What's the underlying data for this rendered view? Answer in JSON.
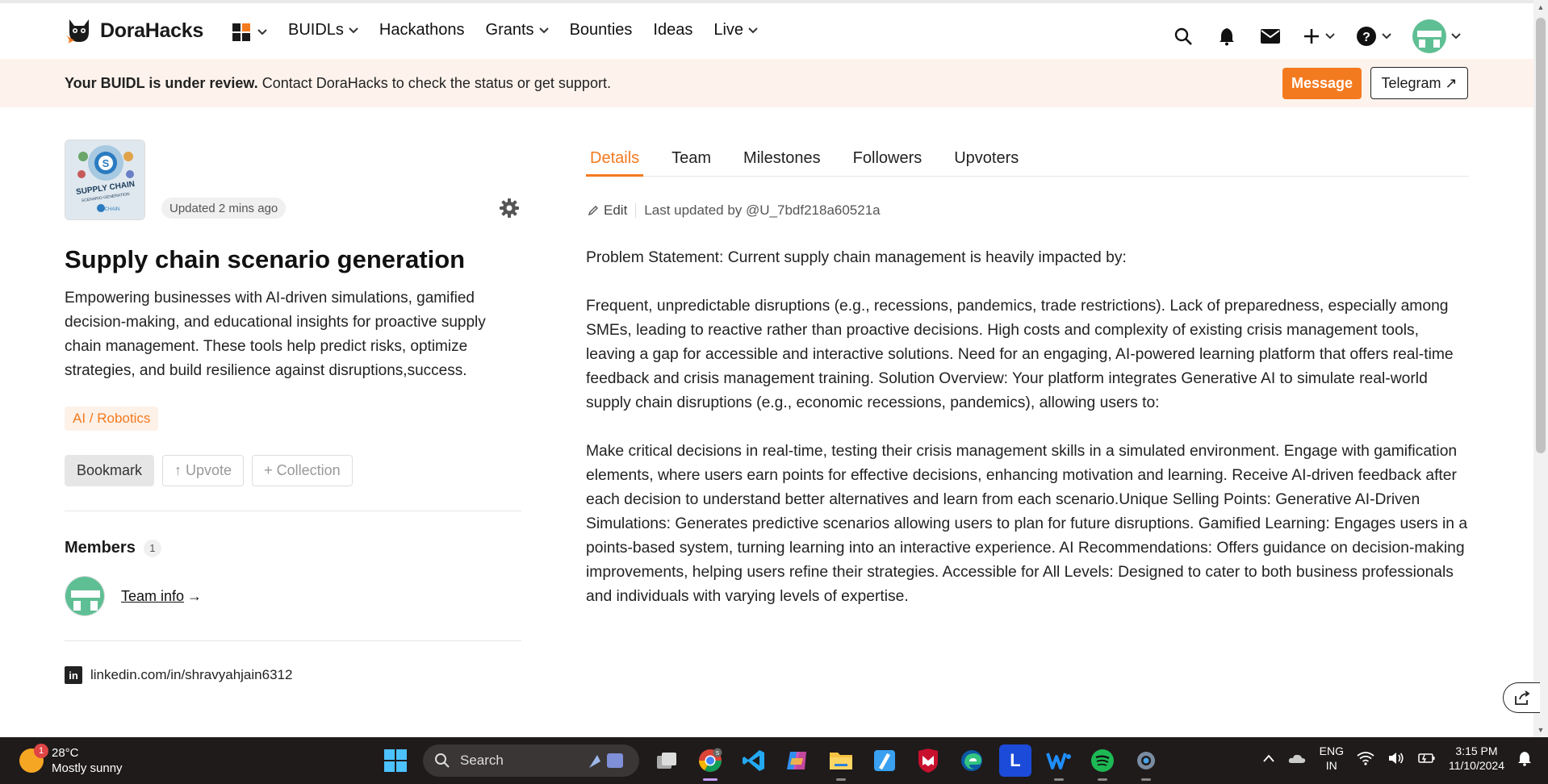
{
  "nav": {
    "brand": "DoraHacks",
    "items": [
      {
        "label": "BUIDLs",
        "dropdown": true
      },
      {
        "label": "Hackathons",
        "dropdown": false
      },
      {
        "label": "Grants",
        "dropdown": true
      },
      {
        "label": "Bounties",
        "dropdown": false
      },
      {
        "label": "Ideas",
        "dropdown": false
      },
      {
        "label": "Live",
        "dropdown": true
      }
    ],
    "icons": [
      "apps-grid-icon",
      "search-icon",
      "bell-icon",
      "mail-icon",
      "plus-icon",
      "help-icon",
      "avatar"
    ]
  },
  "banner": {
    "bold": "Your BUIDL is under review.",
    "text": " Contact DoraHacks to check the status or get support.",
    "message_btn": "Message",
    "telegram_btn": "Telegram ↗"
  },
  "project": {
    "updated": "Updated 2 mins ago",
    "title": "Supply chain scenario generation",
    "description": "Empowering businesses with AI-driven simulations, gamified decision-making, and educational insights for proactive supply chain management. These tools help predict risks, optimize strategies, and build resilience against disruptions,success.",
    "tag": "AI / Robotics",
    "actions": {
      "bookmark": "Bookmark",
      "upvote": "↑ Upvote",
      "collection": "+ Collection"
    },
    "members_label": "Members",
    "members_count": "1",
    "team_info": "Team info",
    "team_arrow": "→",
    "linkedin": "linkedin.com/in/shravyahjain6312",
    "thumb_text": {
      "line1": "SUPPLY CHAIN",
      "line2": "SCENARIO GENERATION",
      "line3": "CHAIN",
      "badge": "S"
    }
  },
  "tabs": [
    {
      "label": "Details",
      "active": true
    },
    {
      "label": "Team",
      "active": false
    },
    {
      "label": "Milestones",
      "active": false
    },
    {
      "label": "Followers",
      "active": false
    },
    {
      "label": "Upvoters",
      "active": false
    }
  ],
  "details": {
    "edit": "Edit",
    "last_updated": "Last updated by @U_7bdf218a60521a",
    "paragraphs": [
      "Problem Statement: Current supply chain management is heavily impacted by:",
      "Frequent, unpredictable disruptions (e.g., recessions, pandemics, trade restrictions). Lack of preparedness, especially among SMEs, leading to reactive rather than proactive decisions. High costs and complexity of existing crisis management tools, leaving a gap for accessible and interactive solutions. Need for an engaging, AI-powered learning platform that offers real-time feedback and crisis management training. Solution Overview: Your platform integrates Generative AI to simulate real-world supply chain disruptions (e.g., economic recessions, pandemics), allowing users to:",
      "Make critical decisions in real-time, testing their crisis management skills in a simulated environment. Engage with gamification elements, where users earn points for effective decisions, enhancing motivation and learning. Receive AI-driven feedback after each decision to understand better alternatives and learn from each scenario.Unique Selling Points: Generative AI-Driven Simulations: Generates predictive scenarios allowing users to plan for future disruptions. Gamified Learning: Engages users in a points-based system, turning learning into an interactive experience. AI Recommendations: Offers guidance on decision-making improvements, helping users refine their strategies. Accessible for All Levels: Designed to cater to both business professionals and individuals with varying levels of expertise."
    ]
  },
  "taskbar": {
    "weather_temp": "28°C",
    "weather_desc": "Mostly sunny",
    "weather_badge": "1",
    "search": "Search",
    "lang_top": "ENG",
    "lang_bottom": "IN",
    "time": "3:15 PM",
    "date": "11/10/2024",
    "chrome_badge": "S",
    "app_letter_L": "L"
  },
  "colors": {
    "accent": "#f47a1f",
    "banner_bg": "#fdf3ec",
    "avatar_green": "#5fbf94"
  }
}
